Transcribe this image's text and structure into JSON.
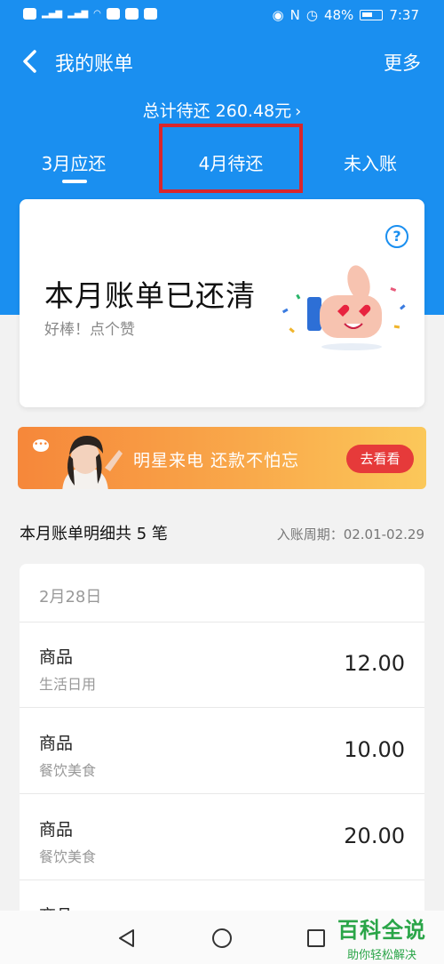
{
  "status_bar": {
    "battery": "48%",
    "time": "7:37"
  },
  "header": {
    "title": "我的账单",
    "more": "更多",
    "total": "总计待还 260.48元",
    "tabs": [
      "3月应还",
      "4月待还",
      "未入账"
    ]
  },
  "summary_card": {
    "title": "本月账单已还清",
    "subtitle": "好棒！点个赞",
    "help_icon": "question-icon"
  },
  "banner": {
    "text": "明星来电  还款不怕忘",
    "button": "去看看"
  },
  "details": {
    "title": "本月账单明细共 5 笔",
    "period": "入账周期：02.01-02.29",
    "date_header": "2月28日",
    "items": [
      {
        "name": "商品",
        "category": "生活日用",
        "amount": "12.00"
      },
      {
        "name": "商品",
        "category": "餐饮美食",
        "amount": "10.00"
      },
      {
        "name": "商品",
        "category": "餐饮美食",
        "amount": "20.00"
      },
      {
        "name": "商品",
        "category": "",
        "amount": ""
      }
    ]
  },
  "watermark": {
    "line1": "百科全说",
    "line2": "助你轻松解决"
  },
  "colors": {
    "primary_blue": "#1a8ff0",
    "highlight_red": "#d9262c",
    "banner_orange": "#f6873a",
    "button_red": "#e63a3a",
    "watermark_green": "#2aa548"
  }
}
